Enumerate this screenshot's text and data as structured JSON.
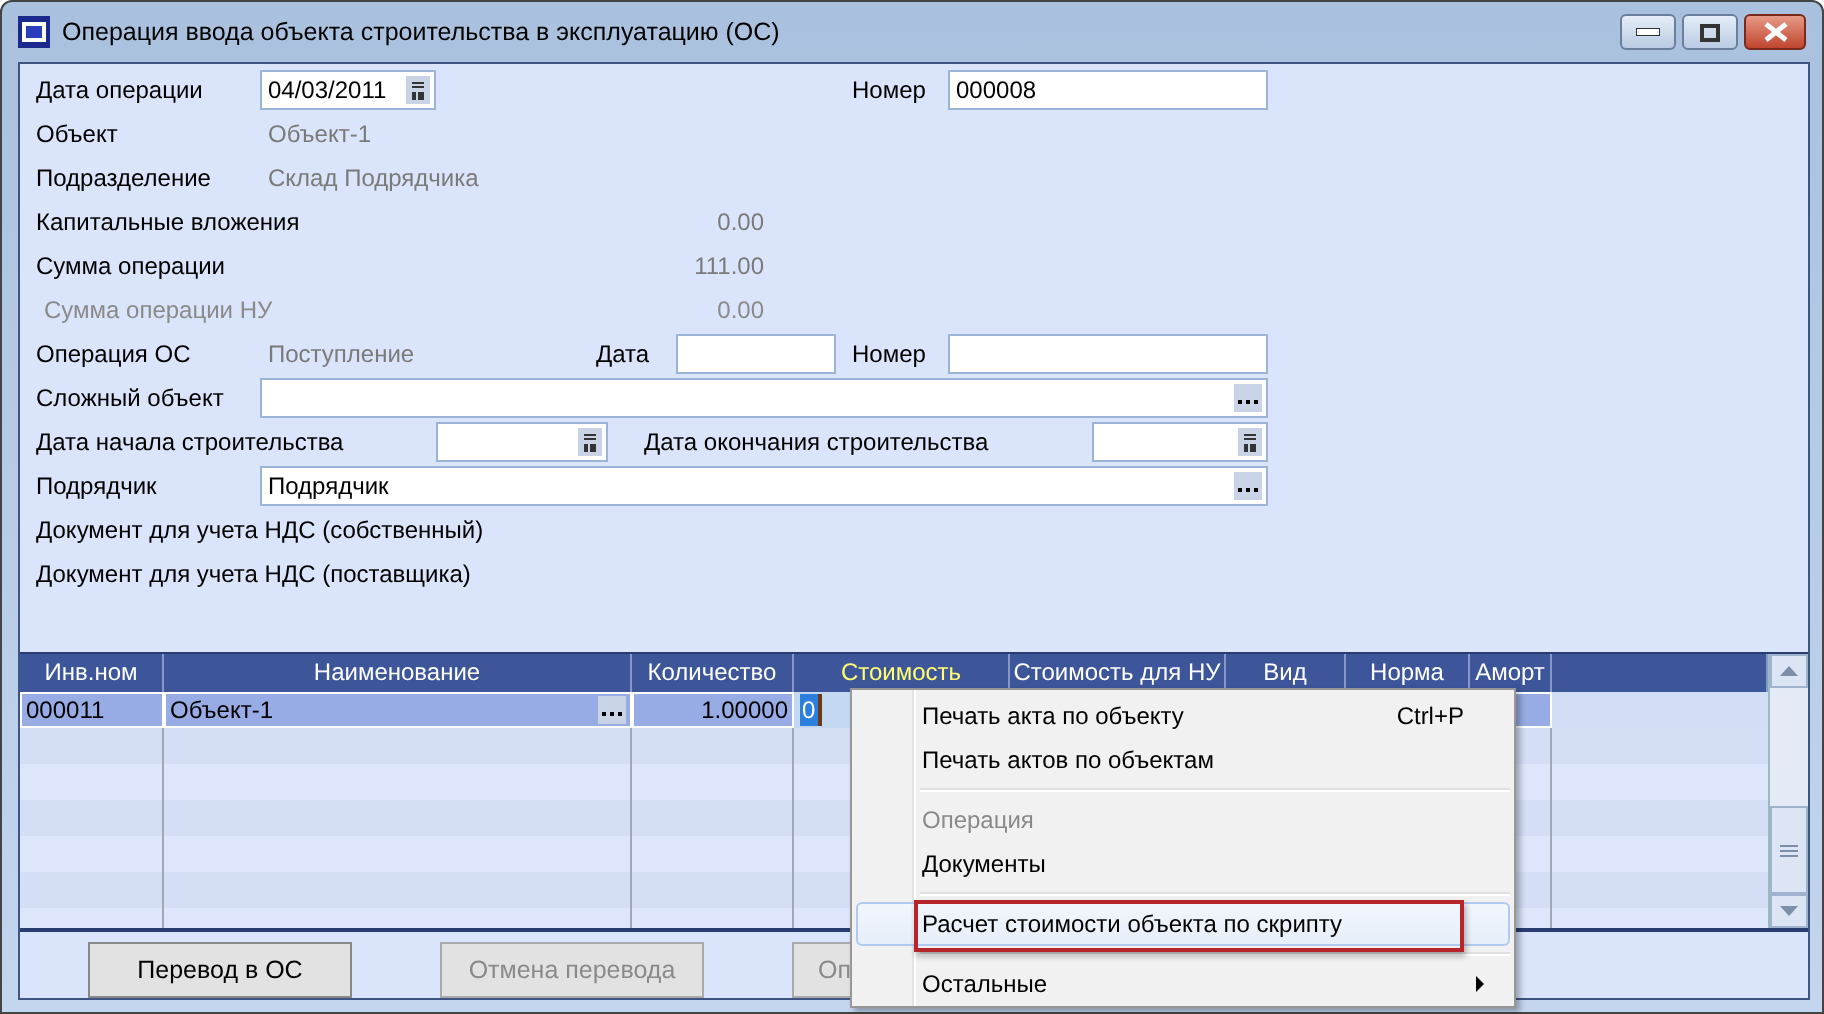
{
  "window": {
    "title": "Операция ввода объекта строительства в эксплуатацию (ОС)"
  },
  "form": {
    "operation_date": {
      "label": "Дата операции",
      "value": "04/03/2011"
    },
    "number": {
      "label": "Номер",
      "value": "000008"
    },
    "info_rows": [
      {
        "kind": "text",
        "label": "Объект",
        "value": "Объект-1",
        "disabled": false
      },
      {
        "kind": "text",
        "label": "Подразделение",
        "value": "Склад Подрядчика",
        "disabled": false
      },
      {
        "kind": "amount",
        "label": "Капитальные вложения",
        "value": "0.00",
        "disabled": false
      },
      {
        "kind": "amount",
        "label": "Сумма операции",
        "value": "111.00",
        "disabled": false
      },
      {
        "kind": "amount",
        "label": "Сумма операции НУ",
        "value": "0.00",
        "disabled": true
      }
    ],
    "os_operation": {
      "label": "Операция ОС",
      "value": "Поступление",
      "date_label": "Дата",
      "number_label": "Номер"
    },
    "complex_object": {
      "label": "Сложный объект"
    },
    "construction": {
      "start_label": "Дата начала строительства",
      "end_label": "Дата окончания строительства"
    },
    "contractor": {
      "label": "Подрядчик",
      "value": "Подрядчик"
    },
    "vat_docs": [
      "Документ для учета НДС (собственный)",
      "Документ для учета НДС (поставщика)"
    ]
  },
  "grid": {
    "columns": [
      {
        "label": "Инв.ном",
        "selected": false
      },
      {
        "label": "Наименование",
        "selected": false
      },
      {
        "label": "Количество",
        "selected": false
      },
      {
        "label": "Стоимость",
        "selected": true
      },
      {
        "label": "Стоимость для НУ",
        "selected": false
      },
      {
        "label": "Вид",
        "selected": false
      },
      {
        "label": "Норма",
        "selected": false
      },
      {
        "label": "Аморт",
        "selected": false
      }
    ],
    "rows": [
      {
        "selected": true,
        "cells": [
          "000011",
          "Объект-1",
          "1.00000",
          "0"
        ]
      }
    ]
  },
  "buttons": [
    {
      "label": "Перевод в ОС",
      "disabled": false
    },
    {
      "label": "Отмена перевода",
      "disabled": true
    },
    {
      "label": "Оп",
      "disabled": true
    }
  ],
  "context_menu": [
    {
      "kind": "item",
      "label": "Печать акта по объекту",
      "shortcut": "Ctrl+P",
      "disabled": false,
      "selected": false
    },
    {
      "kind": "item",
      "label": "Печать актов по объектам",
      "disabled": false,
      "selected": false
    },
    {
      "kind": "separator"
    },
    {
      "kind": "item",
      "label": "Операция",
      "disabled": true,
      "selected": false
    },
    {
      "kind": "item",
      "label": "Документы",
      "disabled": false,
      "selected": false
    },
    {
      "kind": "separator"
    },
    {
      "kind": "item",
      "label": "Расчет стоимости объекта по скрипту",
      "disabled": false,
      "selected": true,
      "annotated": true
    },
    {
      "kind": "separator"
    },
    {
      "kind": "submenu",
      "label": "Остальные",
      "disabled": false,
      "selected": false
    }
  ]
}
